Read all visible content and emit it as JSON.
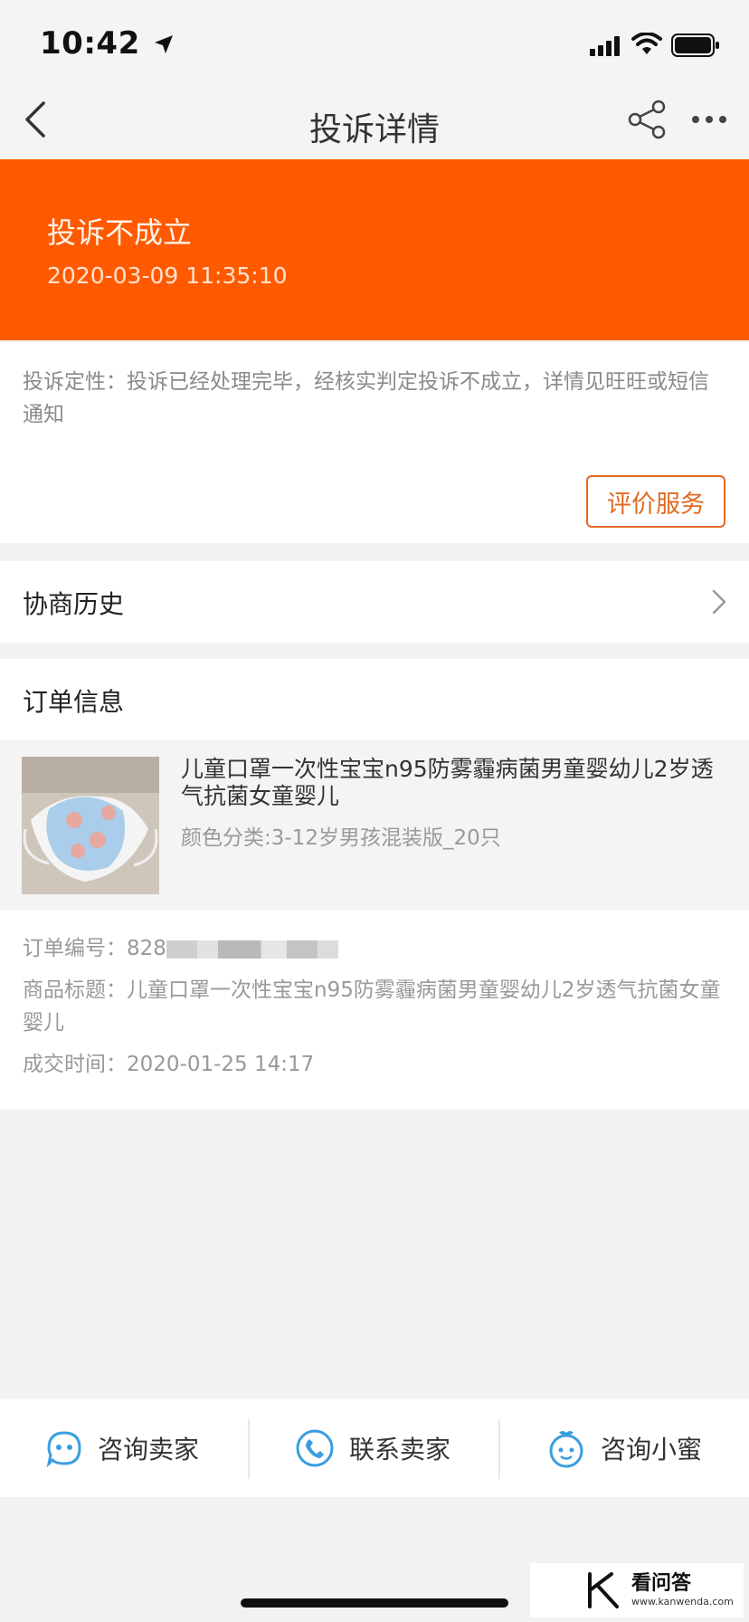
{
  "status_bar": {
    "time": "10:42"
  },
  "nav": {
    "title": "投诉详情"
  },
  "banner": {
    "title": "投诉不成立",
    "datetime": "2020-03-09 11:35:10",
    "color": "#ff5a00"
  },
  "result": {
    "note": "投诉定性：投诉已经处理完毕，经核实判定投诉不成立，详情见旺旺或短信通知",
    "rate_button": "评价服务"
  },
  "history": {
    "label": "协商历史"
  },
  "order": {
    "section_title": "订单信息",
    "product_title": "儿童口罩一次性宝宝n95防雾霾病菌男童婴幼儿2岁透气抗菌女童婴儿",
    "product_spec": "颜色分类:3-12岁男孩混装版_20只",
    "order_no_label": "订单编号：",
    "order_no_visible": "828",
    "item_title_label": "商品标题：",
    "item_title_value": "儿童口罩一次性宝宝n95防雾霾病菌男童婴幼儿2岁透气抗菌女童婴儿",
    "deal_time_label": "成交时间：",
    "deal_time_value": "2020-01-25 14:17"
  },
  "bottom_bar": {
    "consult_seller": "咨询卖家",
    "contact_seller": "联系卖家",
    "consult_xiaomi": "咨询小蜜"
  },
  "watermark": {
    "brand": "看问答",
    "url": "www.kanwenda.com"
  },
  "icons": [
    "back-icon",
    "share-icon",
    "more-icon",
    "chevron-right-icon",
    "chat-bubble-icon",
    "phone-icon",
    "assistant-icon"
  ]
}
